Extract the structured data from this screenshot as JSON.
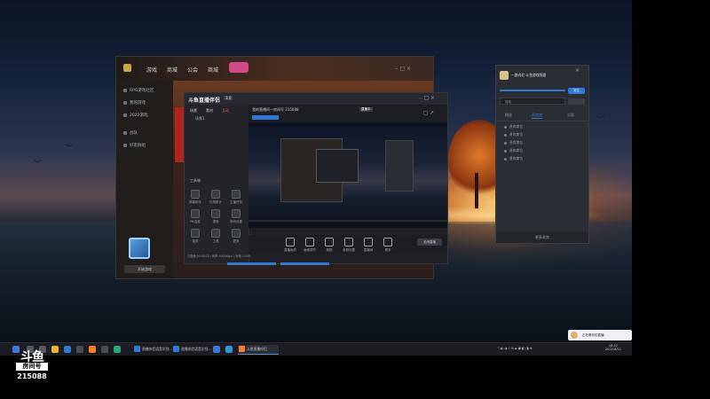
{
  "desktop": {
    "taskbar": {
      "apps": [
        {
          "label": "直播伴侣语音识别..."
        },
        {
          "label": "直播伴侣语音识别..."
        },
        {
          "label": "斗鱼直播伴侣"
        }
      ],
      "clock_time": "18:42",
      "clock_date": "2022/8/11"
    },
    "toast": {
      "text": "正在看你的直播"
    }
  },
  "game_client": {
    "tabs": [
      "游戏",
      "商城",
      "公会",
      "商城"
    ],
    "sidebar": [
      "RPG游戏社区",
      "我的游戏",
      "2022游戏",
      "战队",
      "好友群组"
    ],
    "bottom_button": "开始游戏"
  },
  "recorder": {
    "title": "斗鱼直播伴侣",
    "version": "3.0",
    "left_tabs": [
      "场景",
      "素材",
      "互动"
    ],
    "scene": "场景1",
    "tools_label": "工具箱",
    "panel_tools": [
      "弹幕助手",
      "礼物统计",
      "主播任务",
      "PK连麦",
      "语音",
      "房间设置",
      "抽奖",
      "工具",
      "更多"
    ],
    "header_title": "我的直播间—房间号 215088",
    "header_badge": "直播中",
    "bottom_tools": [
      "直播画质",
      "画面调节",
      "美颜",
      "音频设置",
      "直播间",
      "更多"
    ],
    "status_text": "已直播 00:58:23 | 码率 3000kbps | 丢帧 0.00%",
    "stop_button": "关闭直播"
  },
  "chat_panel": {
    "title": "一路向北·斗鱼游戏频道",
    "follow_button": "关注",
    "input_placeholder": "搜索",
    "tabs": [
      "粉丝",
      "贵宾席",
      "公告"
    ],
    "items": [
      "贵宾席位",
      "贵宾席位",
      "贵宾席位",
      "贵宾席位",
      "贵宾席位"
    ],
    "footer": "更多贵宾"
  },
  "watermark": {
    "brand": "斗鱼",
    "room_label": "房间号",
    "room_number": "215088"
  },
  "colors": {
    "accent": "#2f7ad6",
    "panel": "#2a2d33"
  }
}
